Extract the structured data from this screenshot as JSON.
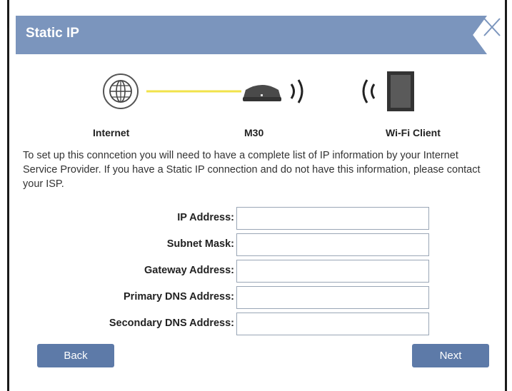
{
  "dialog": {
    "title": "Static IP",
    "close_icon": "close-icon"
  },
  "diagram": {
    "internet_label": "Internet",
    "router_label": "M30",
    "client_label": "Wi-Fi Client",
    "link_color": "#f1e34a"
  },
  "description": "To set up this conncetion you will need to have a complete list of IP information by your Internet Service Provider. If you have a Static IP connection and do not have this information, please contact your ISP.",
  "fields": [
    {
      "label": "IP Address:",
      "value": ""
    },
    {
      "label": "Subnet Mask:",
      "value": ""
    },
    {
      "label": "Gateway Address:",
      "value": ""
    },
    {
      "label": "Primary DNS Address:",
      "value": ""
    },
    {
      "label": "Secondary DNS Address:",
      "value": ""
    }
  ],
  "buttons": {
    "back": "Back",
    "next": "Next"
  },
  "colors": {
    "header": "#7b95bd",
    "button": "#5d7aa8"
  }
}
